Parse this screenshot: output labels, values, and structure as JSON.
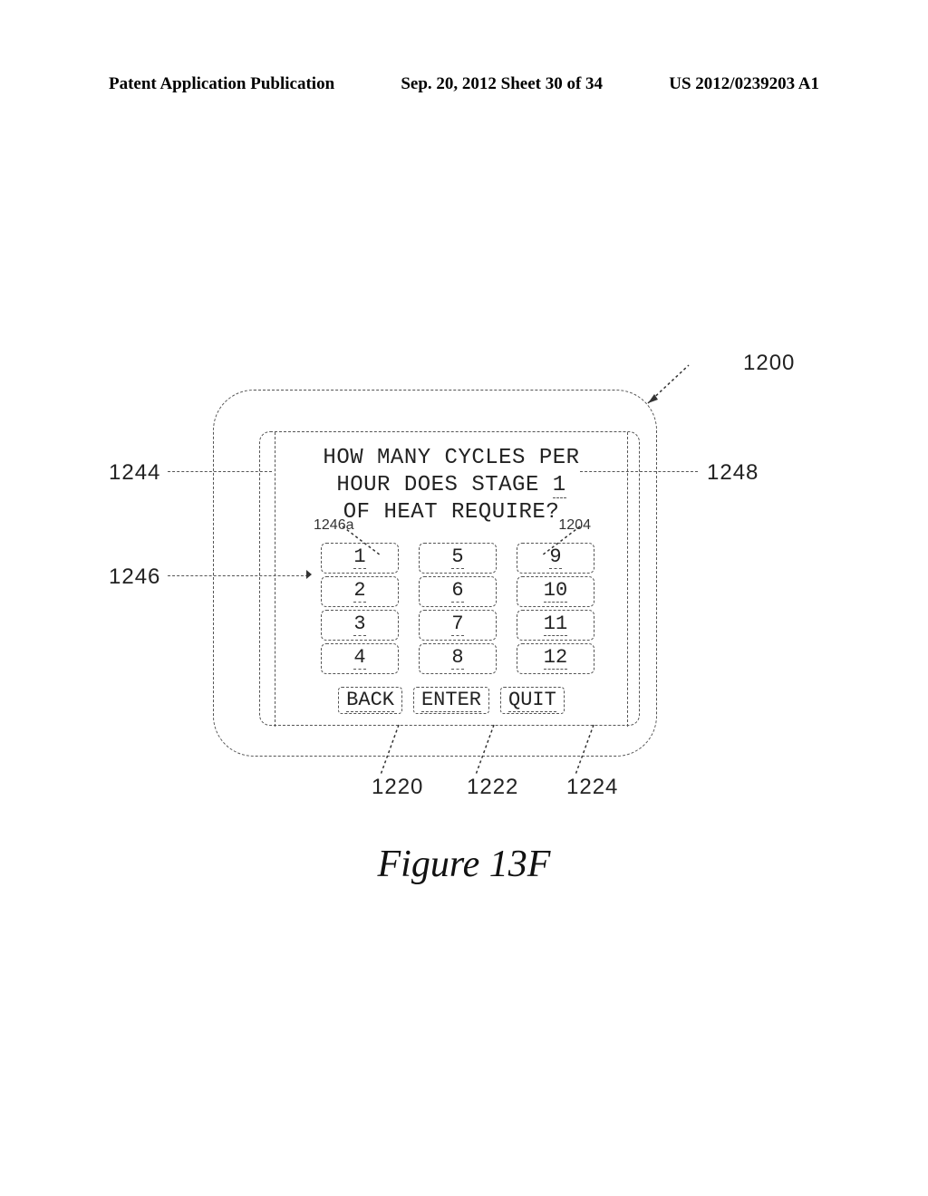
{
  "header": {
    "left": "Patent Application Publication",
    "center": "Sep. 20, 2012  Sheet 30 of 34",
    "right": "US 2012/0239203 A1"
  },
  "screen": {
    "prompt_line1": "HOW MANY CYCLES PER",
    "prompt_line2_a": "HOUR DOES STAGE ",
    "prompt_line2_b": "1",
    "prompt_line3": "OF HEAT REQUIRE?",
    "inline_label_left": "1246a",
    "inline_label_right": "1204",
    "keys": [
      "1",
      "5",
      "9",
      "2",
      "6",
      "10",
      "3",
      "7",
      "11",
      "4",
      "8",
      "12"
    ],
    "nav": {
      "back": "BACK",
      "enter": "ENTER",
      "quit": "QUIT"
    }
  },
  "refs": {
    "r1200": "1200",
    "r1244": "1244",
    "r1246": "1246",
    "r1248": "1248",
    "r1220": "1220",
    "r1222": "1222",
    "r1224": "1224"
  },
  "caption": "Figure 13F"
}
